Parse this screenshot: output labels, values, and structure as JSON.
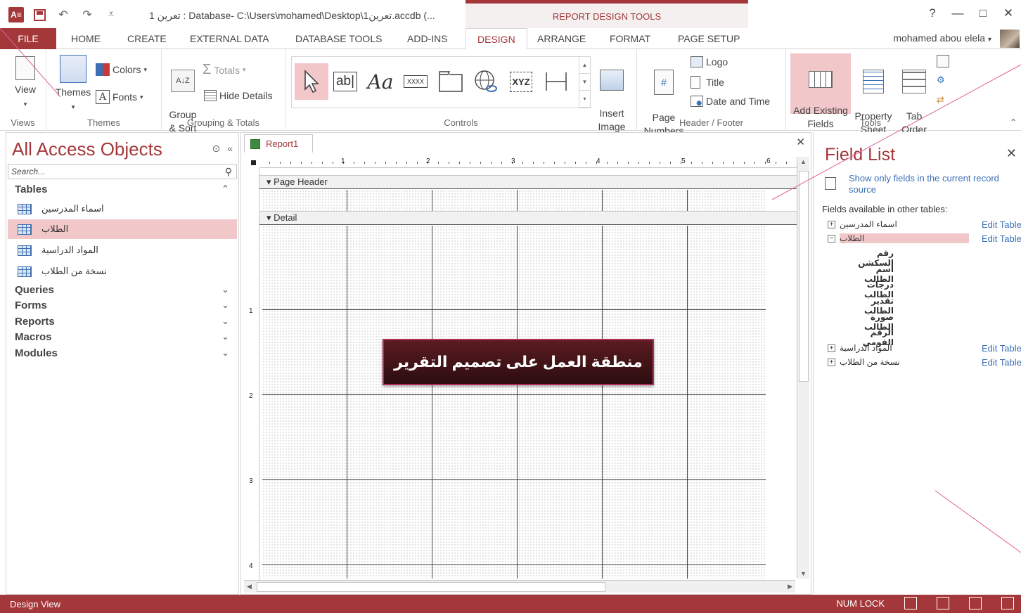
{
  "window": {
    "title": "تعرين 1 : Database- C:\\Users\\mohamed\\Desktop\\تعرين1.accdb (...",
    "contextual_header": "REPORT DESIGN TOOLS",
    "help": "?",
    "minimize": "—",
    "restore": "□",
    "close": "✕"
  },
  "tabs": {
    "file": "FILE",
    "home": "HOME",
    "create": "CREATE",
    "external_data": "EXTERNAL DATA",
    "database_tools": "DATABASE TOOLS",
    "add_ins": "ADD-INS",
    "design": "DESIGN",
    "arrange": "ARRANGE",
    "format": "FORMAT",
    "page_setup": "PAGE SETUP"
  },
  "user": {
    "name": "mohamed abou elela"
  },
  "ribbon": {
    "views": {
      "label": "Views",
      "view": "View"
    },
    "themes": {
      "label": "Themes",
      "themes": "Themes",
      "colors": "Colors",
      "fonts": "Fonts"
    },
    "grouping": {
      "label": "Grouping & Totals",
      "group_sort": "Group\n& Sort",
      "totals": "Totals",
      "hide_details": "Hide Details"
    },
    "controls": {
      "label": "Controls",
      "text_box": "ab|",
      "label_control": "Aa",
      "button": "XXXX",
      "chart": "XYZ",
      "insert_image": "Insert\nImage"
    },
    "header_footer": {
      "label": "Header / Footer",
      "page_numbers": "Page\nNumbers",
      "logo": "Logo",
      "title": "Title",
      "date_time": "Date and Time"
    },
    "tools": {
      "label": "Tools",
      "add_existing_fields": "Add Existing\nFields",
      "property_sheet": "Property\nSheet",
      "tab_order": "Tab\nOrder"
    }
  },
  "nav": {
    "title": "All Access Objects",
    "search_placeholder": "Search...",
    "tables_label": "Tables",
    "tables": [
      "اسماء المدرسين",
      "الطلاب",
      "المواد الدراسية",
      "نسخة من الطلاب"
    ],
    "selected_table": "الطلاب",
    "sections": [
      "Queries",
      "Forms",
      "Reports",
      "Macros",
      "Modules"
    ]
  },
  "document": {
    "tab": "Report1",
    "page_header": "Page Header",
    "detail": "Detail",
    "ruler_top": [
      "1",
      "2",
      "3",
      "4",
      "5",
      "6"
    ],
    "ruler_left": [
      "1",
      "2",
      "3",
      "4"
    ],
    "callout": "منطقة العمل على تصميم التقرير"
  },
  "field_list": {
    "title": "Field List",
    "show_only": "Show only fields in the current record source",
    "available": "Fields available in other tables:",
    "edit_table": "Edit Table",
    "tables": [
      {
        "name": "اسماء المدرسين",
        "expanded": false
      },
      {
        "name": "الطلاب",
        "expanded": true
      },
      {
        "name": "المواد الدراسية",
        "expanded": false
      },
      {
        "name": "نسخة من الطلاب",
        "expanded": false
      }
    ],
    "fields": [
      "رقم السكشن",
      "اسم الطالب",
      "درجات الطالب",
      "تقدير الطالب",
      "صورة الطالب",
      "الرقم القومي"
    ]
  },
  "status": {
    "left": "Design View",
    "num_lock": "NUM LOCK"
  },
  "colors": {
    "accent": "#a4373a",
    "selection": "#f2c7c9",
    "link": "#3b6fb6"
  }
}
